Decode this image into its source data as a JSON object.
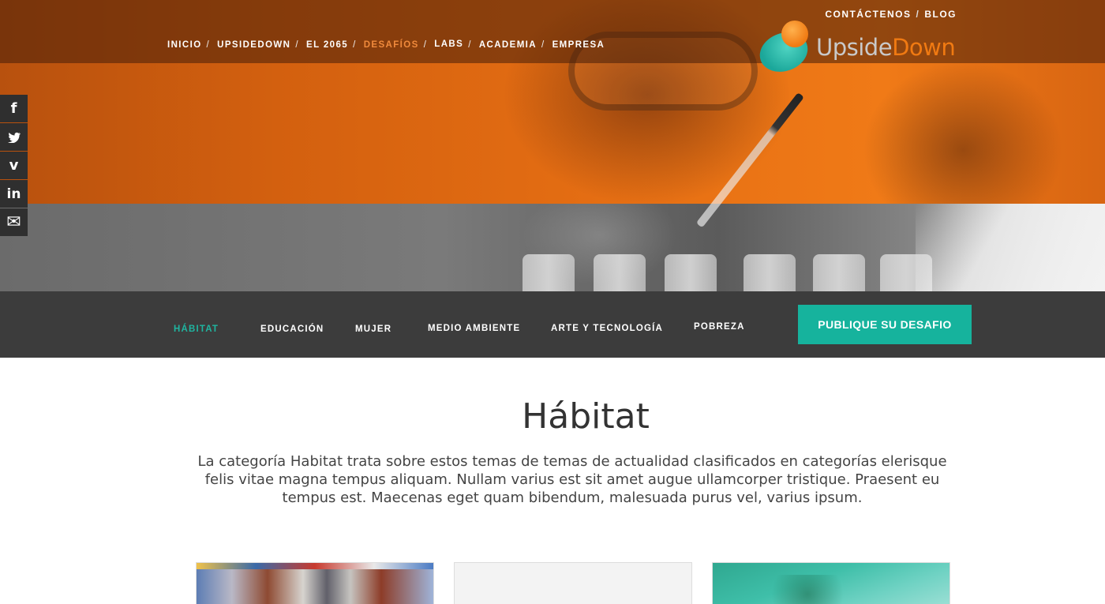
{
  "header": {
    "utility_nav": [
      "CONTÁCTENOS",
      "BLOG"
    ],
    "main_nav": [
      {
        "label": "INICIO",
        "active": false
      },
      {
        "label": "UPSIDEDOWN",
        "active": false
      },
      {
        "label": "EL 2065",
        "active": false
      },
      {
        "label": "DESAFÍOS",
        "active": true
      },
      {
        "label": "LABS",
        "active": false
      },
      {
        "label": "ACADEMIA",
        "active": false
      },
      {
        "label": "EMPRESA",
        "active": false
      }
    ],
    "logo": {
      "text_part1": "Upside",
      "text_part2": "Down"
    }
  },
  "social": [
    {
      "name": "facebook-icon",
      "glyph": "f"
    },
    {
      "name": "twitter-icon",
      "glyph": "🐦"
    },
    {
      "name": "vimeo-icon",
      "glyph": "v"
    },
    {
      "name": "linkedin-icon",
      "glyph": "in"
    },
    {
      "name": "mail-icon",
      "glyph": "✉"
    }
  ],
  "categories": [
    {
      "label": "HÁBITAT",
      "active": true
    },
    {
      "label": "EDUCACIÓN",
      "active": false
    },
    {
      "label": "MUJER",
      "active": false
    },
    {
      "label": "MEDIO AMBIENTE",
      "active": false
    },
    {
      "label": "ARTE Y TECNOLOGÍA",
      "active": false
    },
    {
      "label": "POBREZA",
      "active": false
    }
  ],
  "cta_label": "PUBLIQUE SU DESAFIO",
  "page": {
    "title": "Hábitat",
    "description": "La categoría Habitat trata sobre estos temas  de temas de actualidad clasificados en categorías  elerisque felis vitae magna tempus aliquam. Nullam varius est sit amet augue ullamcorper tristique. Praesent eu tempus est. Maecenas eget quam bibendum, malesuada purus vel, varius ipsum."
  },
  "colors": {
    "accent_teal": "#16b39d",
    "accent_orange": "#f07a12",
    "dark_bar": "#3c3c3c"
  }
}
